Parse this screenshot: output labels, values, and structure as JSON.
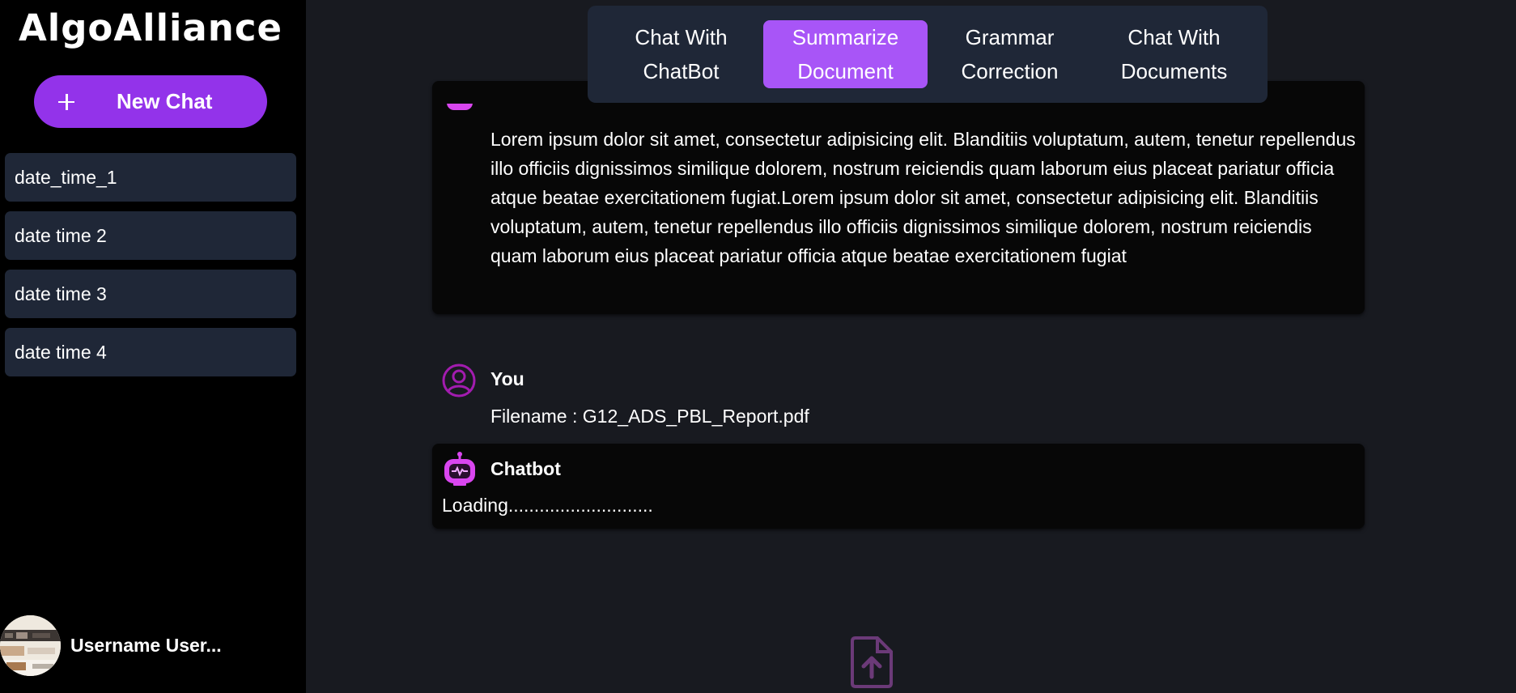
{
  "app": {
    "title": "AlgoAlliance"
  },
  "sidebar": {
    "new_chat_label": "New Chat",
    "history": [
      {
        "label": "date_time_1"
      },
      {
        "label": "date time 2"
      },
      {
        "label": "date time 3"
      },
      {
        "label": "date time 4"
      }
    ],
    "username": "Username User..."
  },
  "tabs": [
    {
      "label": "Chat With ChatBot",
      "active": false
    },
    {
      "label": "Summarize Document",
      "active": true
    },
    {
      "label": "Grammar Correction",
      "active": false
    },
    {
      "label": "Chat With Documents",
      "active": false
    }
  ],
  "chat": {
    "bot_summary_text": "Lorem ipsum dolor sit amet, consectetur adipisicing elit. Blanditiis voluptatum, autem, tenetur repellendus illo officiis dignissimos similique dolorem, nostrum reiciendis quam laborum eius placeat pariatur officia atque beatae exercitationem fugiat.Lorem ipsum dolor sit amet, consectetur adipisicing elit. Blanditiis voluptatum, autem, tenetur repellendus illo officiis dignissimos similique dolorem, nostrum reiciendis quam laborum eius placeat pariatur officia atque beatae exercitationem fugiat",
    "user_sender": "You",
    "user_message": "Filename : G12_ADS_PBL_Report.pdf",
    "bot_sender": "Chatbot",
    "bot_loading": "Loading............................"
  },
  "colors": {
    "accent": "#9333ea",
    "tab_active": "#a855f7",
    "panel": "#1f2737",
    "icon_magenta": "#a21caf",
    "upload_icon": "#6b3a78"
  },
  "icons": {
    "new_chat": "plus-icon",
    "user_message": "user-circle-icon",
    "bot_message": "robot-icon",
    "upload": "file-upload-icon"
  }
}
